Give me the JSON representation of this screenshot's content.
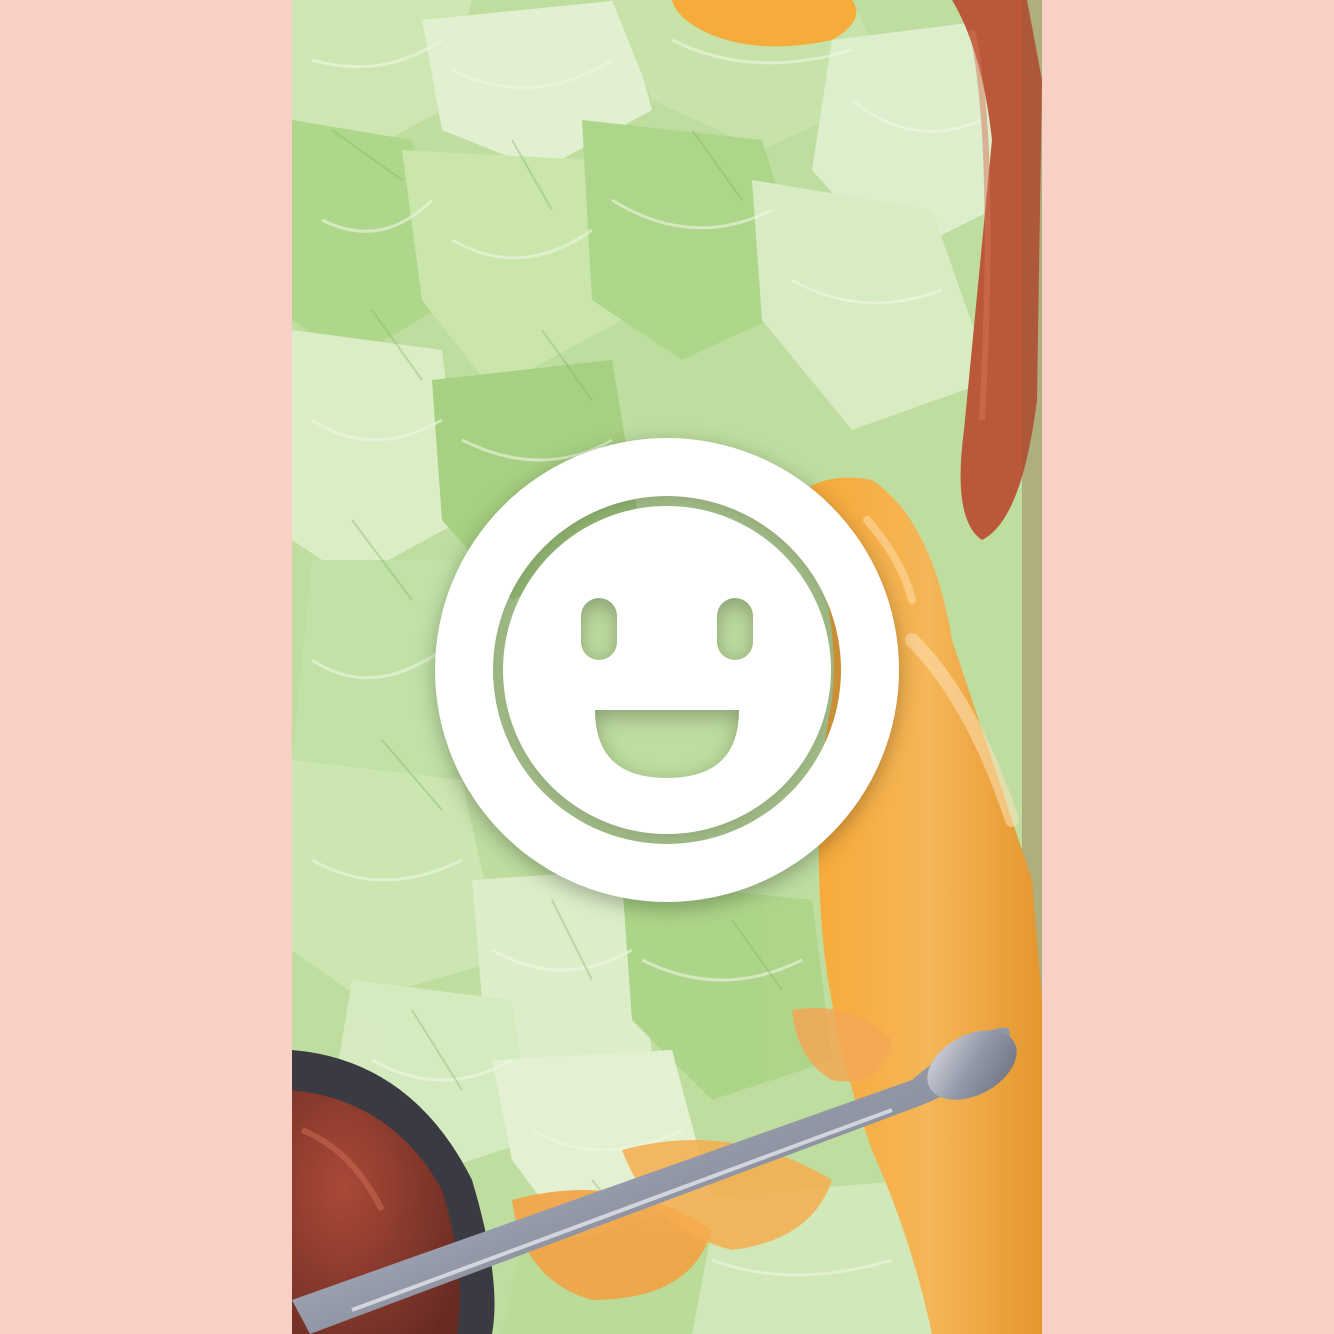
{
  "page": {
    "background_color": "#f9d0c6"
  },
  "photo": {
    "subject": "salad-with-lettuce-peppers-and-spoon",
    "colors": {
      "lettuce_light": "#dff0c6",
      "lettuce_mid": "#b7dd92",
      "lettuce_dark": "#7fb861",
      "pepper_orange": "#f7a224",
      "pepper_red": "#b64a2a",
      "sauce": "#8e2c1e",
      "spoon_metal": "#9aa0ad"
    }
  },
  "overlay": {
    "icon": "smiley-face-icon",
    "color": "#ffffff"
  }
}
